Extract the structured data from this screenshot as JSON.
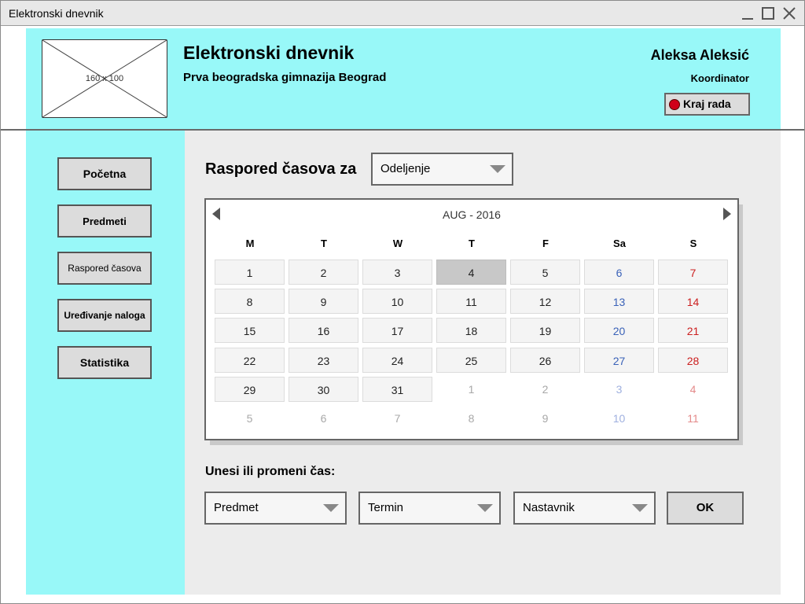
{
  "window": {
    "title": "Elektronski dnevnik"
  },
  "header": {
    "logo_placeholder": "160 x 100",
    "app_title": "Elektronski dnevnik",
    "school": "Prva beogradska gimnazija Beograd",
    "user_name": "Aleksa Aleksić",
    "user_role": "Koordinator",
    "logout_label": "Kraj rada"
  },
  "sidebar": {
    "items": [
      {
        "label": "Početna",
        "active": false
      },
      {
        "label": "Predmeti",
        "active": false
      },
      {
        "label": "Raspored časova",
        "active": true
      },
      {
        "label": "Uređivanje naloga",
        "active": false
      },
      {
        "label": "Statistika",
        "active": false
      }
    ]
  },
  "schedule": {
    "label": "Raspored časova za",
    "class_dropdown": "Odeljenje"
  },
  "calendar": {
    "month_label": "AUG - 2016",
    "weekdays": [
      "M",
      "T",
      "W",
      "T",
      "F",
      "Sa",
      "S"
    ],
    "selected_day": 4,
    "weeks": [
      [
        "1",
        "2",
        "3",
        "4",
        "5",
        "6",
        "7"
      ],
      [
        "8",
        "9",
        "10",
        "11",
        "12",
        "13",
        "14"
      ],
      [
        "15",
        "16",
        "17",
        "18",
        "19",
        "20",
        "21"
      ],
      [
        "22",
        "23",
        "24",
        "25",
        "26",
        "27",
        "28"
      ],
      [
        "29",
        "30",
        "31",
        "1",
        "2",
        "3",
        "4"
      ],
      [
        "5",
        "6",
        "7",
        "8",
        "9",
        "10",
        "11"
      ]
    ],
    "current_month_days": 31
  },
  "form": {
    "label": "Unesi ili promeni čas:",
    "subject_dropdown": "Predmet",
    "term_dropdown": "Termin",
    "teacher_dropdown": "Nastavnik",
    "ok_label": "OK"
  },
  "colors": {
    "accent_bg": "#98f8f8",
    "active_nav": "#e8202a",
    "saturday": "#3a62b8",
    "sunday": "#cc1f1f"
  }
}
